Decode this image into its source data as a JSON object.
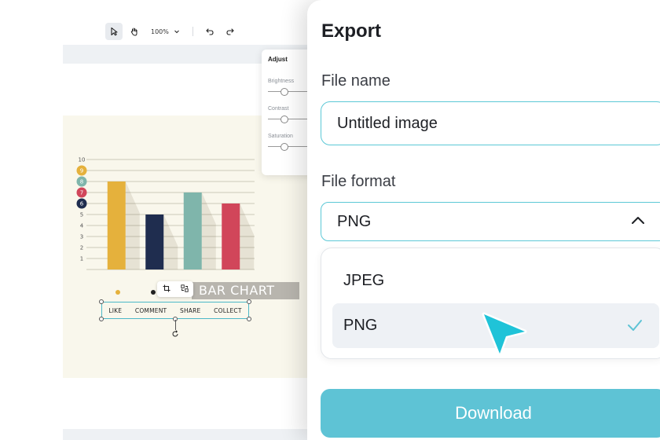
{
  "toolbar": {
    "zoom_label": "100%"
  },
  "adjust_panel": {
    "title": "Adjust",
    "sliders": [
      {
        "label": "Brightness",
        "value": 0.35
      },
      {
        "label": "Contrast",
        "value": 0.35
      },
      {
        "label": "Saturation",
        "value": 0.35
      }
    ]
  },
  "chart_data": {
    "type": "bar",
    "title": "BAR CHART",
    "categories": [
      "LIKE",
      "COMMENT",
      "SHARE",
      "COLLECT"
    ],
    "values": [
      8,
      5,
      7,
      6
    ],
    "colors": [
      "#e5b13c",
      "#1f2d4f",
      "#7fb5ab",
      "#d1465a"
    ],
    "ylim": [
      0,
      10
    ],
    "yticks": [
      1,
      2,
      3,
      4,
      5,
      6,
      7,
      8,
      9,
      10
    ],
    "highlighted_ticks": [
      {
        "tick": 9,
        "color": "#e5b13c"
      },
      {
        "tick": 8,
        "color": "#7fb5ab"
      },
      {
        "tick": 7,
        "color": "#d1465a"
      },
      {
        "tick": 6,
        "color": "#1f2d4f"
      }
    ],
    "grid": true
  },
  "export": {
    "title": "Export",
    "file_name_label": "File name",
    "file_name_value": "Untitled image",
    "file_format_label": "File format",
    "selected_format": "PNG",
    "options": [
      {
        "label": "JPEG",
        "selected": false
      },
      {
        "label": "PNG",
        "selected": true
      }
    ],
    "download_label": "Download",
    "accent_color": "#5ec3d5"
  }
}
